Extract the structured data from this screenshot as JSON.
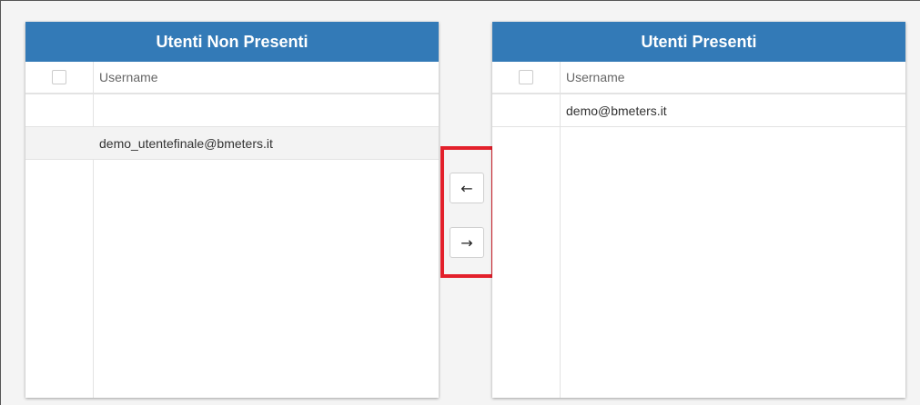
{
  "left_panel": {
    "title": "Utenti Non Presenti",
    "column_header": "Username",
    "rows": [
      "",
      "demo_utentefinale@bmeters.it"
    ]
  },
  "right_panel": {
    "title": "Utenti Presenti",
    "column_header": "Username",
    "rows": [
      "demo@bmeters.it"
    ]
  },
  "controls": {
    "move_left_icon": "←",
    "move_right_icon": "→",
    "highlight_color": "#e3202b"
  },
  "colors": {
    "header_bg": "#337ab7",
    "header_text": "#ffffff"
  }
}
